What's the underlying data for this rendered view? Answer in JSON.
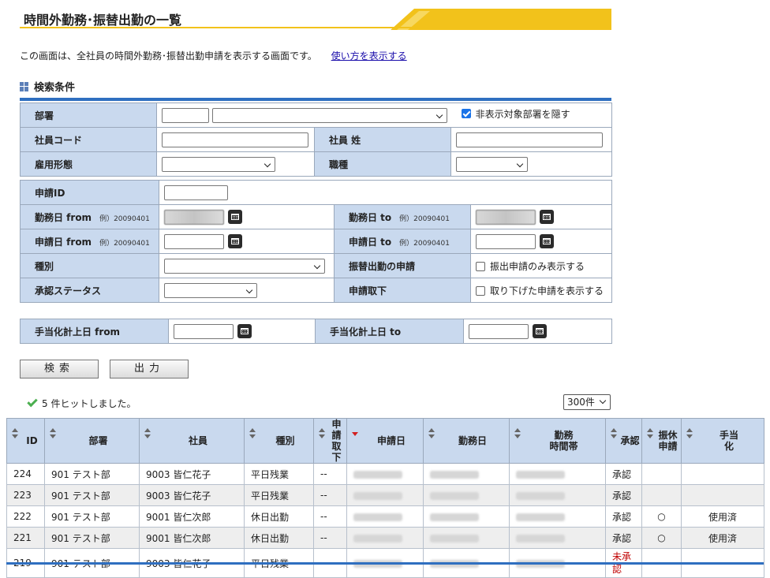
{
  "page": {
    "title": "時間外勤務･振替出勤の一覧",
    "intro": "この画面は、全社員の時間外勤務･振替出勤申請を表示する画面です。",
    "howto_link": "使い方を表示する",
    "search_section_title": "検索条件"
  },
  "colors": {
    "accent_yellow": "#f2c21b",
    "header_blue": "#c9d9ee",
    "rule_blue": "#2f6fc0",
    "unapproved_red": "#c00000"
  },
  "search": {
    "dept_label": "部署",
    "hide_hidden_dept_label": "非表示対象部署を隠す",
    "hide_hidden_dept_checked": true,
    "emp_code_label": "社員コード",
    "emp_lastname_label": "社員 姓",
    "employment_type_label": "雇用形態",
    "job_type_label": "職種",
    "app_id_label": "申請ID",
    "work_date_from_label": "勤務日 from",
    "work_date_to_label": "勤務日 to",
    "date_example": "例）20090401",
    "app_date_from_label": "申請日 from",
    "app_date_to_label": "申請日 to",
    "kind_label": "種別",
    "transfer_label": "振替出勤の申請",
    "transfer_only_label": "振出申請のみ表示する",
    "transfer_only_checked": false,
    "approval_status_label": "承認ステータス",
    "withdraw_label": "申請取下",
    "show_withdrawn_label": "取り下げた申請を表示する",
    "show_withdrawn_checked": false,
    "allowance_from_label": "手当化計上日 from",
    "allowance_to_label": "手当化計上日 to",
    "search_button": "検索",
    "output_button": "出力"
  },
  "results": {
    "hit_text": "5 件ヒットしました。",
    "page_size": "300件",
    "columns": {
      "id": "ID",
      "dept": "部署",
      "emp": "社員",
      "kind": "種別",
      "withdraw_1": "申請",
      "withdraw_2": "取下",
      "app_date": "申請日",
      "work_date": "勤務日",
      "work_time_1": "勤務",
      "work_time_2": "時間帯",
      "approval": "承認",
      "transfer_1": "振休",
      "transfer_2": "申請",
      "allowance_1": "手当",
      "allowance_2": "化"
    },
    "rows": [
      {
        "id": "224",
        "dept": "901 テスト部",
        "emp": "9003 皆仁花子",
        "kind": "平日残業",
        "withdraw": "--",
        "approval": "承認",
        "transfer": "",
        "allowance": ""
      },
      {
        "id": "223",
        "dept": "901 テスト部",
        "emp": "9003 皆仁花子",
        "kind": "平日残業",
        "withdraw": "--",
        "approval": "承認",
        "transfer": "",
        "allowance": ""
      },
      {
        "id": "222",
        "dept": "901 テスト部",
        "emp": "9001 皆仁次郎",
        "kind": "休日出勤",
        "withdraw": "--",
        "approval": "承認",
        "transfer": "○",
        "allowance": "使用済"
      },
      {
        "id": "221",
        "dept": "901 テスト部",
        "emp": "9001 皆仁次郎",
        "kind": "休日出勤",
        "withdraw": "--",
        "approval": "承認",
        "transfer": "○",
        "allowance": "使用済"
      },
      {
        "id": "219",
        "dept": "901 テスト部",
        "emp": "9003 皆仁花子",
        "kind": "平日残業",
        "withdraw": "--",
        "approval_1": "未承",
        "approval_2": "認",
        "transfer": "",
        "allowance": ""
      }
    ]
  }
}
